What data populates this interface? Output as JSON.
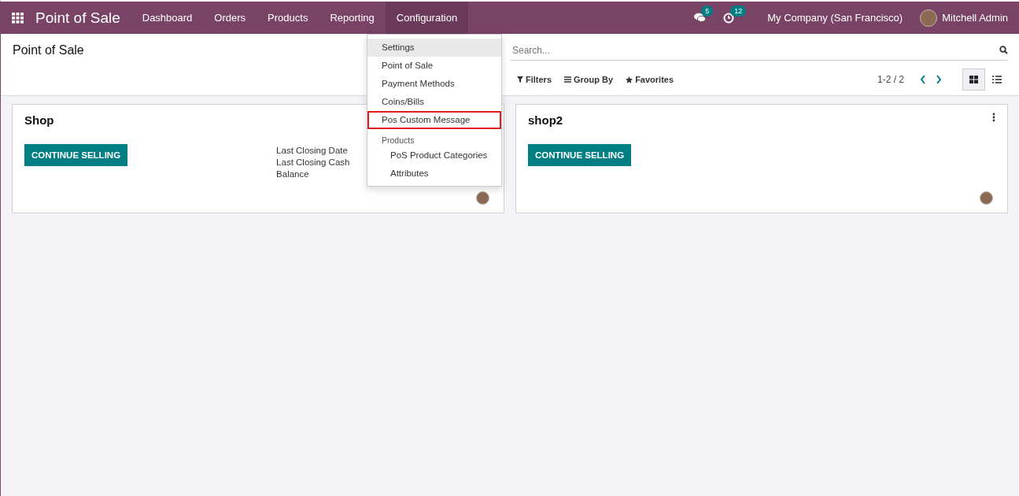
{
  "navbar": {
    "app_title": "Point of Sale",
    "menu": [
      {
        "label": "Dashboard",
        "selected": false
      },
      {
        "label": "Orders",
        "selected": false
      },
      {
        "label": "Products",
        "selected": false
      },
      {
        "label": "Reporting",
        "selected": false
      },
      {
        "label": "Configuration",
        "selected": true
      }
    ],
    "messages_count": "5",
    "activities_count": "12",
    "company": "My Company (San Francisco)",
    "user": "Mitchell Admin"
  },
  "dropdown": {
    "items": [
      {
        "kind": "item",
        "label": "Settings",
        "hovered": true,
        "outlined": false
      },
      {
        "kind": "item",
        "label": "Point of Sale",
        "hovered": false,
        "outlined": false
      },
      {
        "kind": "item",
        "label": "Payment Methods",
        "hovered": false,
        "outlined": false
      },
      {
        "kind": "item",
        "label": "Coins/Bills",
        "hovered": false,
        "outlined": false
      },
      {
        "kind": "item",
        "label": "Pos Custom Message",
        "hovered": false,
        "outlined": true
      },
      {
        "kind": "header",
        "label": "Products",
        "hovered": false,
        "outlined": false
      },
      {
        "kind": "subitem",
        "label": "PoS Product Categories",
        "hovered": false,
        "outlined": false
      },
      {
        "kind": "subitem",
        "label": "Attributes",
        "hovered": false,
        "outlined": false
      }
    ]
  },
  "control_panel": {
    "breadcrumb": "Point of Sale",
    "search": {
      "placeholder": "Search..."
    },
    "filters": [
      "Filters",
      "Group By",
      "Favorites"
    ],
    "pager": "1-2 / 2",
    "views": [
      {
        "kind": "kanban",
        "selected": true
      },
      {
        "kind": "list",
        "selected": false
      }
    ]
  },
  "cards": [
    {
      "name": "Shop",
      "button": "CONTINUE SELLING",
      "stats": [
        "Last Closing Date",
        "Last Closing Cash",
        "Balance"
      ]
    },
    {
      "name": "shop2",
      "button": "CONTINUE SELLING",
      "menu_visible": true
    }
  ]
}
